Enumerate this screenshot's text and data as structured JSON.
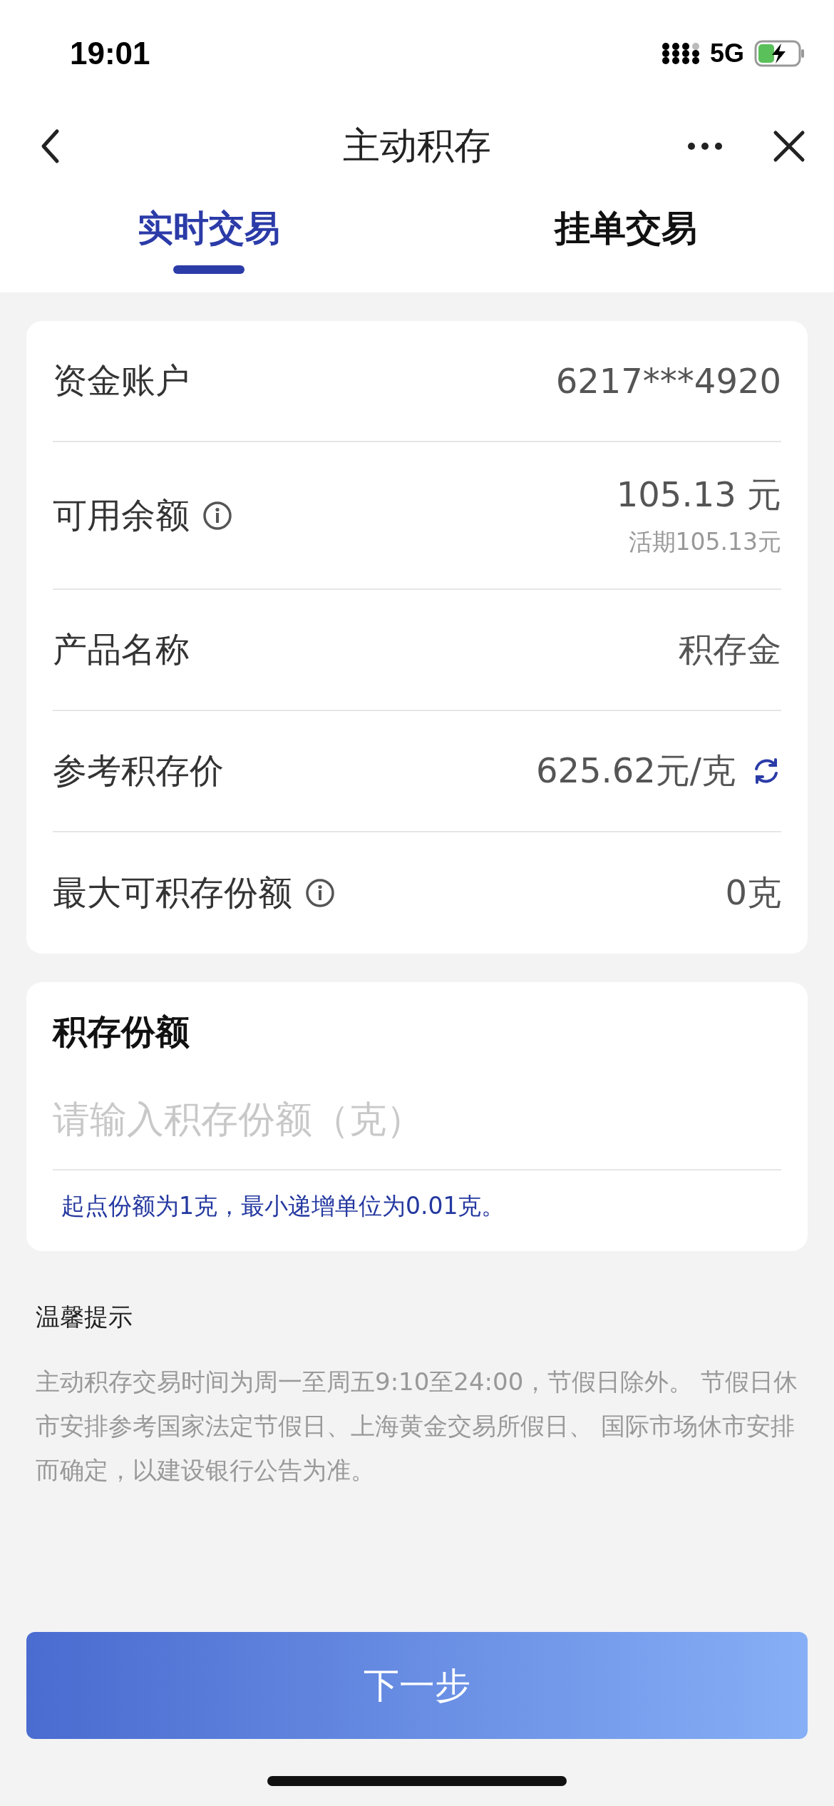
{
  "status_bar": {
    "time": "19:01",
    "network": "5G"
  },
  "nav": {
    "title": "主动积存"
  },
  "tabs": [
    {
      "label": "实时交易",
      "selected": true
    },
    {
      "label": "挂单交易",
      "selected": false
    }
  ],
  "account_rows": [
    {
      "label": "资金账户",
      "value": "6217***4920",
      "kind": "plain"
    },
    {
      "label": "可用余额",
      "value": "105.13 元",
      "sub": "活期105.13元",
      "kind": "info"
    },
    {
      "label": "产品名称",
      "value": "积存金",
      "kind": "plain"
    },
    {
      "label": "参考积存价",
      "value": "625.62元/克",
      "kind": "refresh"
    },
    {
      "label": "最大可积存份额",
      "value": "0克",
      "kind": "info"
    }
  ],
  "amount": {
    "title": "积存份额",
    "placeholder": "请输入积存份额（克）",
    "hint": "起点份额为1克，最小递增单位为0.01克。"
  },
  "tips": {
    "title": "温馨提示",
    "text": "主动积存交易时间为周一至周五9:10至24:00，节假日除外。 节假日休市安排参考国家法定节假日、上海黄金交易所假日、 国际市场休市安排而确定，以建设银行公告为准。"
  },
  "button": {
    "label": "下一步"
  }
}
